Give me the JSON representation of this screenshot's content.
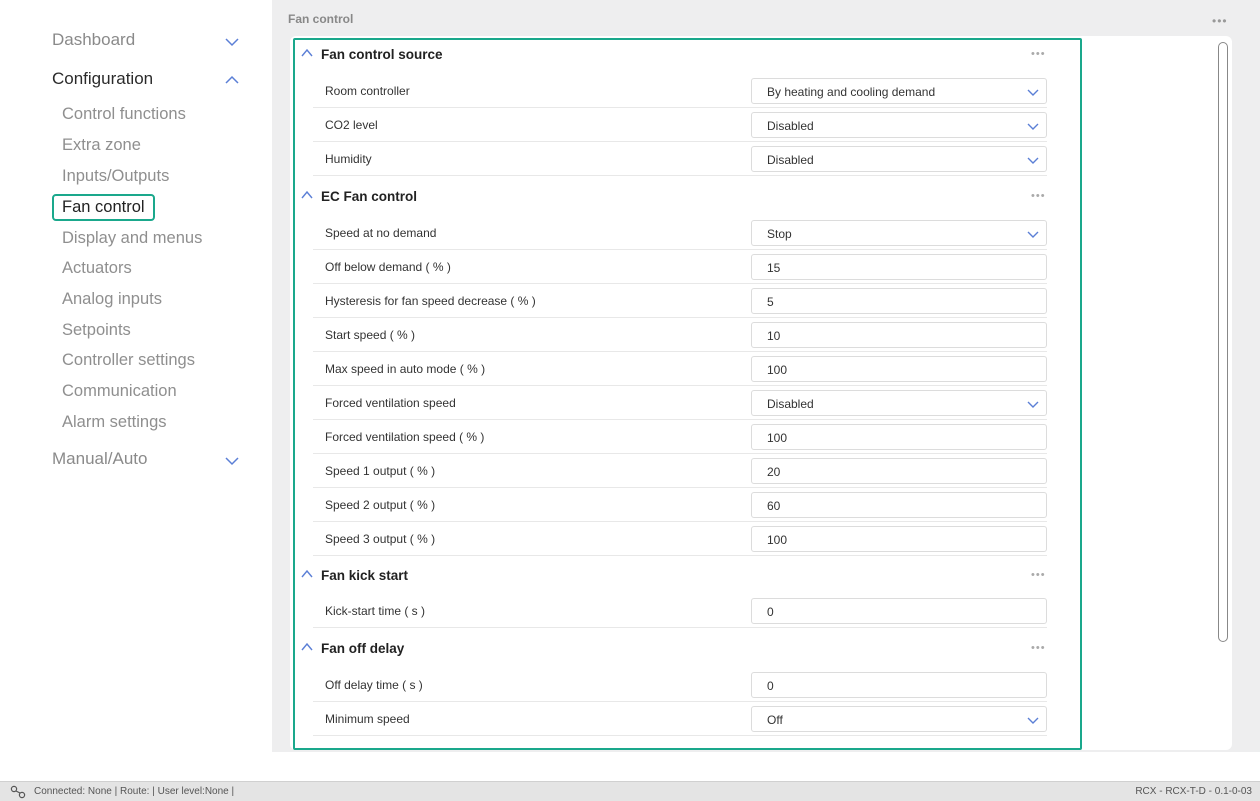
{
  "sidebar": {
    "dashboard": "Dashboard",
    "configuration": "Configuration",
    "config_items": [
      "Control functions",
      "Extra zone",
      "Inputs/Outputs",
      "Fan control",
      "Display and menus",
      "Actuators",
      "Analog inputs",
      "Setpoints",
      "Controller settings",
      "Communication",
      "Alarm settings"
    ],
    "manual_auto": "Manual/Auto"
  },
  "main": {
    "title": "Fan control",
    "more": "•••"
  },
  "sections": {
    "s0": {
      "title": "Fan control source",
      "rows": [
        {
          "label": "Room controller",
          "value": "By heating and cooling demand"
        },
        {
          "label": "CO2 level",
          "value": "Disabled"
        },
        {
          "label": "Humidity",
          "value": "Disabled"
        }
      ]
    },
    "s1": {
      "title": "EC Fan control",
      "rows": [
        {
          "label": "Speed at no demand",
          "value": "Stop"
        },
        {
          "label": "Off below demand ( % )",
          "value": "15"
        },
        {
          "label": "Hysteresis for fan speed decrease ( % )",
          "value": "5"
        },
        {
          "label": "Start speed ( % )",
          "value": "10"
        },
        {
          "label": "Max speed in auto mode ( % )",
          "value": "100"
        },
        {
          "label": "Forced ventilation speed",
          "value": "Disabled"
        },
        {
          "label": "Forced ventilation speed ( % )",
          "value": "100"
        },
        {
          "label": "Speed 1 output ( % )",
          "value": "20"
        },
        {
          "label": "Speed 2 output ( % )",
          "value": "60"
        },
        {
          "label": "Speed 3 output ( % )",
          "value": "100"
        }
      ]
    },
    "s2": {
      "title": "Fan kick start",
      "rows": [
        {
          "label": "Kick-start time ( s )",
          "value": "0"
        }
      ]
    },
    "s3": {
      "title": "Fan off delay",
      "rows": [
        {
          "label": "Off delay time ( s )",
          "value": "0"
        },
        {
          "label": "Minimum speed",
          "value": "Off"
        }
      ]
    },
    "more": "•••"
  },
  "statusbar": {
    "status": "Connected: None | Route: | User level:None |",
    "version": "RCX - RCX-T-D - 0.1-0-03"
  },
  "colors": {
    "accent": "#1aa88c",
    "chevron": "#5b7fd6"
  }
}
